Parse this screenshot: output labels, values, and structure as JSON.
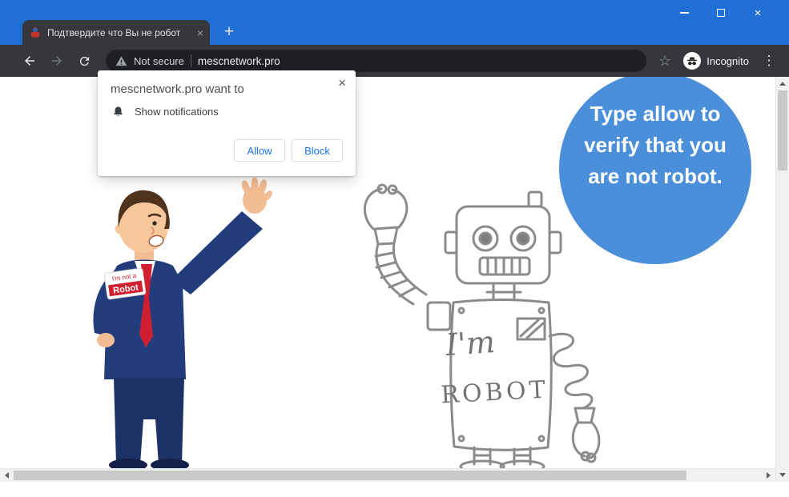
{
  "titlebar": {
    "tab_title": "Подтвердите что Вы не робот",
    "icons": {
      "tab_close": "×",
      "new_tab": "+",
      "window_close": "×"
    }
  },
  "toolbar": {
    "not_secure_label": "Not secure",
    "url": "mescnetwork.pro",
    "incognito_label": "Incognito",
    "icons": {
      "star": "☆",
      "menu": "⋮"
    }
  },
  "notification_dialog": {
    "title": "mescnetwork.pro want to",
    "permission_label": "Show notifications",
    "allow_button": "Allow",
    "block_button": "Block",
    "icons": {
      "close": "×"
    }
  },
  "bubble": {
    "line1": "Type allow to",
    "line2": "verify that you",
    "line3": "are not robot."
  },
  "man": {
    "badge_line1": "I'm not a",
    "badge_line2": "Robot"
  },
  "robot": {
    "body_line1": "I'm",
    "body_line2": "ROBOT"
  },
  "colors": {
    "titlebar_blue": "#1f6fd6",
    "toolbar_dark": "#36373b",
    "address_bar_dark": "#1f2023",
    "bubble_blue": "#4b8fdb",
    "accent_blue": "#1a73e8",
    "suit_navy": "#233d7c",
    "tie_red": "#cf1f31"
  }
}
